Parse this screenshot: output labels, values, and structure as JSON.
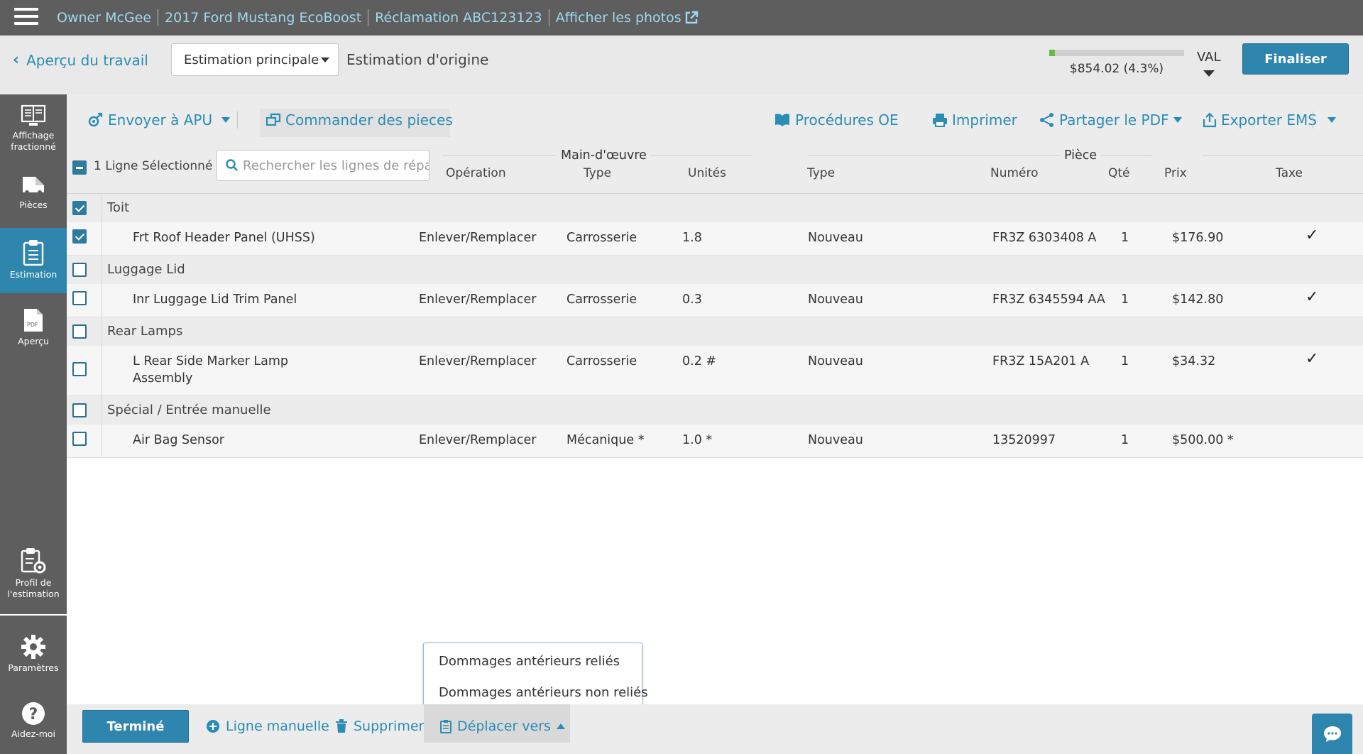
{
  "topbar": {
    "owner": "Owner McGee",
    "vehicle": "2017 Ford Mustang EcoBoost",
    "claim": "Réclamation ABC123123",
    "photos_link": "Afficher les photos"
  },
  "subheader": {
    "back_label": "Aperçu du travail",
    "estimate_select": "Estimation principale",
    "estimate_name": "Estimation d'origine",
    "progress_text": "$854.02 (4.3%)",
    "progress_fraction": 0.043,
    "val_label": "VAL",
    "finalize_label": "Finaliser"
  },
  "sidebar": {
    "items": [
      {
        "label1": "Affichage",
        "label2": "fractionné",
        "icon": "monitor-icon"
      },
      {
        "label1": "Pièces",
        "label2": "",
        "icon": "part-icon"
      },
      {
        "label1": "Estimation",
        "label2": "",
        "icon": "clipboard-icon"
      },
      {
        "label1": "Aperçu",
        "label2": "",
        "icon": "pdf-icon"
      },
      {
        "label1": "Profil de",
        "label2": "l'estimation",
        "icon": "clipboard-gear-icon"
      },
      {
        "label1": "Paramètres",
        "label2": "",
        "icon": "gear-icon"
      },
      {
        "label1": "Aidez-moi",
        "label2": "",
        "icon": "help-icon"
      }
    ]
  },
  "toolbar": {
    "send_apu": "Envoyer à APU",
    "order_parts": "Commander des pieces",
    "oe_procedures": "Procédures OE",
    "print": "Imprimer",
    "share_pdf": "Partager le PDF",
    "export_ems": "Exporter EMS"
  },
  "header": {
    "selected_count": "1 Ligne Sélectionné",
    "search_placeholder": "Rechercher les lignes de réparation",
    "operation": "Opération",
    "labor_group": "Main-d'œuvre",
    "labor_type": "Type",
    "units": "Unités",
    "part_group": "Pièce",
    "part_type": "Type",
    "number": "Numéro",
    "qty": "Qté",
    "price": "Prix",
    "tax": "Taxe"
  },
  "groups": [
    {
      "name": "Toit",
      "checked": true,
      "lines": [
        {
          "desc1": "Frt Roof Header Panel (UHSS)",
          "desc2": "",
          "operation": "Enlever/Remplacer",
          "labor_type": "Carrosserie",
          "units": "1.8",
          "part_type": "Nouveau",
          "number": "FR3Z 6303408 A",
          "qty": "1",
          "price": "$176.90",
          "tax": "✓",
          "checked": true
        }
      ]
    },
    {
      "name": "Luggage Lid",
      "checked": false,
      "lines": [
        {
          "desc1": "Inr Luggage Lid Trim Panel",
          "desc2": "",
          "operation": "Enlever/Remplacer",
          "labor_type": "Carrosserie",
          "units": "0.3",
          "part_type": "Nouveau",
          "number": "FR3Z 6345594 AA",
          "qty": "1",
          "price": "$142.80",
          "tax": "✓",
          "checked": false
        }
      ]
    },
    {
      "name": "Rear Lamps",
      "checked": false,
      "lines": [
        {
          "desc1": "L Rear Side Marker Lamp",
          "desc2": "Assembly",
          "operation": "Enlever/Remplacer",
          "labor_type": "Carrosserie",
          "units": "0.2 #",
          "part_type": "Nouveau",
          "number": "FR3Z 15A201 A",
          "qty": "1",
          "price": "$34.32",
          "tax": "✓",
          "checked": false
        }
      ]
    },
    {
      "name": "Spécial / Entrée manuelle",
      "checked": false,
      "lines": [
        {
          "desc1": "Air Bag Sensor",
          "desc2": "",
          "operation": "Enlever/Remplacer",
          "labor_type": "Mécanique *",
          "units": "1.0 *",
          "part_type": "Nouveau",
          "number": "13520997",
          "qty": "1",
          "price": "$500.00 *",
          "tax": "",
          "checked": false
        }
      ]
    }
  ],
  "popup": {
    "options": [
      "Dommages antérieurs reliés",
      "Dommages antérieurs non reliés"
    ]
  },
  "bottombar": {
    "done_label": "Terminé",
    "manual_line": "Ligne manuelle",
    "delete": "Supprimer",
    "move_to": "Déplacer vers"
  }
}
